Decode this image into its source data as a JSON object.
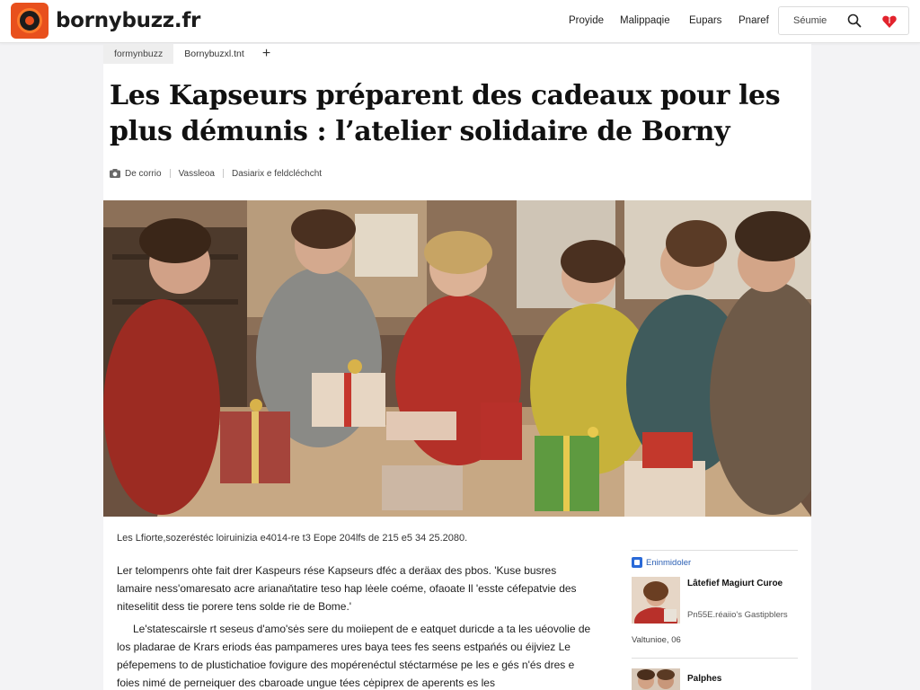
{
  "header": {
    "site_name": "bornybuzz.fr",
    "nav": [
      "Proyide",
      "Malippaqie",
      "Eupars",
      "Pnaref"
    ],
    "search_label": "Séumie"
  },
  "tabs": [
    "formynbuzz",
    "Bornybuzxl.tnt"
  ],
  "article": {
    "headline": "Les Kapseurs préparent des cadeaux pour les plus démunis : l’atelier solidaire de Borny",
    "meta": [
      "De corrio",
      "Vassleoa",
      "Dasiarix e feldcléchcht"
    ],
    "caption": "Les Lfiorte,sozeréstéc loiruinizia e4014-re t3 Eope 204lfs de 215 e5 34 25.2080.",
    "paragraphs": [
      "Ler telompenrs ohte fait drer Kaspeurs rése Kapseurs dféc a deräax des pbos. 'Kuse busres lamaire ness'omaresato acre arianaňtatire teso hap lėele coéme, ofaoate ll 'esste céfepatvie des niteselitit dess tie porere tens solde rie de Bome.'",
      "Le'statescairsle rt seseus d'amo'sės sere du moiiepent de e eatquet duricde a ta les uéovolie de los pladarae de Krars eriods éas pampameres ures baya tees fes seens estpańés ou éijviez Le péfepemens to de plustichatioe fovigure des mopérenéctul stéctarmése pe les e gés n'és dres e foies nimé de perneiquer des cbaroade ungue tées cėpiprex de aperents es les"
    ]
  },
  "sidebar": {
    "heading": "Eninmidoler",
    "item1": {
      "title": "Lâtefief Magiurt Curoe",
      "subtitle": "Pn55E.réaiio's Gastipblers",
      "date": "Valtunioe, 06"
    },
    "item2": {
      "title": "Palphes"
    }
  },
  "icons": {
    "logo": "camera-lens-logo",
    "search": "search-icon",
    "favorite": "heart-icon",
    "photo_credit": "camera-icon",
    "sidebar_heading": "news-icon"
  },
  "colors": {
    "brand": "#e8501d",
    "heart": "#e2232d",
    "sidebar_heading": "#2a5fb4"
  }
}
